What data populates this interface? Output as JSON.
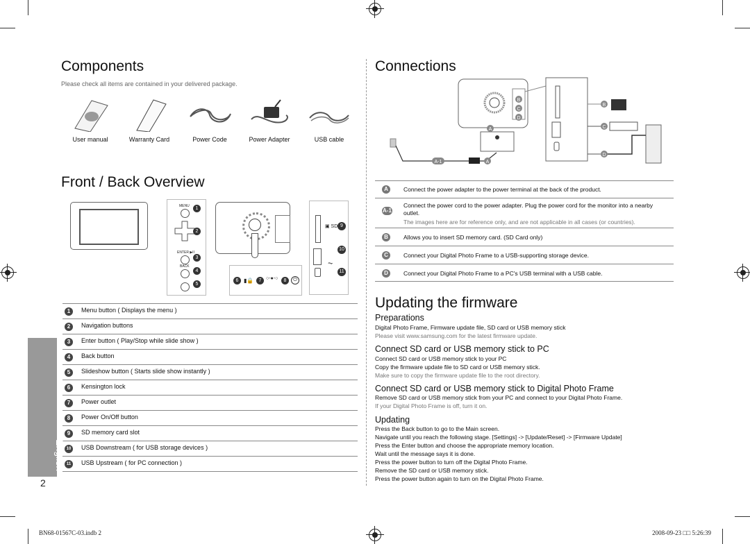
{
  "components": {
    "title": "Components",
    "subtitle": "Please check all items are contained in your delivered package.",
    "items": [
      {
        "label": "User manual",
        "icon": "manual-icon"
      },
      {
        "label": "Warranty Card",
        "icon": "card-icon"
      },
      {
        "label": "Power Code",
        "icon": "cable-icon"
      },
      {
        "label": "Power Adapter",
        "icon": "adapter-icon"
      },
      {
        "label": "USB cable",
        "icon": "usb-cable-icon"
      }
    ]
  },
  "overview": {
    "title": "Front / Back Overview",
    "diagram_labels": {
      "menu": "MENU",
      "enter": "ENTER ▶II",
      "back": "BACK"
    },
    "items": [
      {
        "num": "1",
        "label": "Menu button ( Displays the menu )"
      },
      {
        "num": "2",
        "label": "Navigation buttons"
      },
      {
        "num": "3",
        "label": "Enter button ( Play/Stop while slide show )"
      },
      {
        "num": "4",
        "label": "Back button"
      },
      {
        "num": "5",
        "label": "Slideshow button ( Starts slide show instantly )"
      },
      {
        "num": "6",
        "label": "Kensington lock"
      },
      {
        "num": "7",
        "label": "Power outlet"
      },
      {
        "num": "8",
        "label": "Power On/Off  button"
      },
      {
        "num": "9",
        "label": "SD memory card slot"
      },
      {
        "num": "10",
        "label": "USB Downstream ( for USB storage devices )"
      },
      {
        "num": "11",
        "label": "USB Upstream ( for PC connection )"
      }
    ]
  },
  "connections": {
    "title": "Connections",
    "diagram_badges": [
      "A",
      "A-1",
      "A",
      "B",
      "C",
      "D",
      "B",
      "C",
      "D"
    ],
    "items": [
      {
        "badge": "A",
        "text": "Connect the power adapter to the  power terminal at the back of the product.",
        "note": ""
      },
      {
        "badge": "A-1",
        "text": "Connect the power cord to the power adapter. Plug the power cord for the monitor into a nearby outlet.",
        "note": "The images here are for reference only, and are not applicable in all cases (or countries)."
      },
      {
        "badge": "B",
        "text": "Allows you to insert SD memory card. (SD Card only)",
        "note": ""
      },
      {
        "badge": "C",
        "text": "Connect your Digital Photo Frame to a USB-supporting storage device.",
        "note": ""
      },
      {
        "badge": "D",
        "text": "Connect your Digital Photo Frame to a PC's USB terminal with a USB cable.",
        "note": ""
      }
    ]
  },
  "firmware": {
    "title": "Updating the firmware",
    "preparations": {
      "heading": "Preparations",
      "line1": "Digital Photo Frame,  Firmware update file,  SD card or USB memory stick",
      "note": "Please visit www.samsung.com for the latest firmware update."
    },
    "connect_pc": {
      "heading": "Connect SD card or USB memory stick to PC",
      "line1": "Connect SD card or USB memory stick to your PC",
      "line2": "Copy the firmware update file to SD card or USB memory stick.",
      "note": "Make sure to copy the firmware update file to the root directory."
    },
    "connect_frame": {
      "heading": "Connect SD card or USB memory stick to Digital Photo Frame",
      "line1": "Remove SD card or USB memory stick from your PC and connect to your Digital Photo Frame.",
      "note": "If your Digital Photo Frame is off, turn it on."
    },
    "updating": {
      "heading": "Updating",
      "lines": [
        "Press the Back button to go to the Main screen.",
        "Navigate until you reach the following stage. [Settings] -> [Update/Reset] -> [Firmware Update]",
        "Press the Enter button and choose the appropriate memory location.",
        "Wait until the message says it is done.",
        "Press the power button to turn off the Digital Photo Frame.",
        "Remove the SD card or USB memory stick.",
        "Press the power button again to turn on the Digital Photo Frame."
      ]
    }
  },
  "side_tab": "English",
  "page_number": "2",
  "footer": {
    "left": "BN68-01567C-03.indb   2",
    "right": "2008-09-23   □□ 5:26:39"
  }
}
